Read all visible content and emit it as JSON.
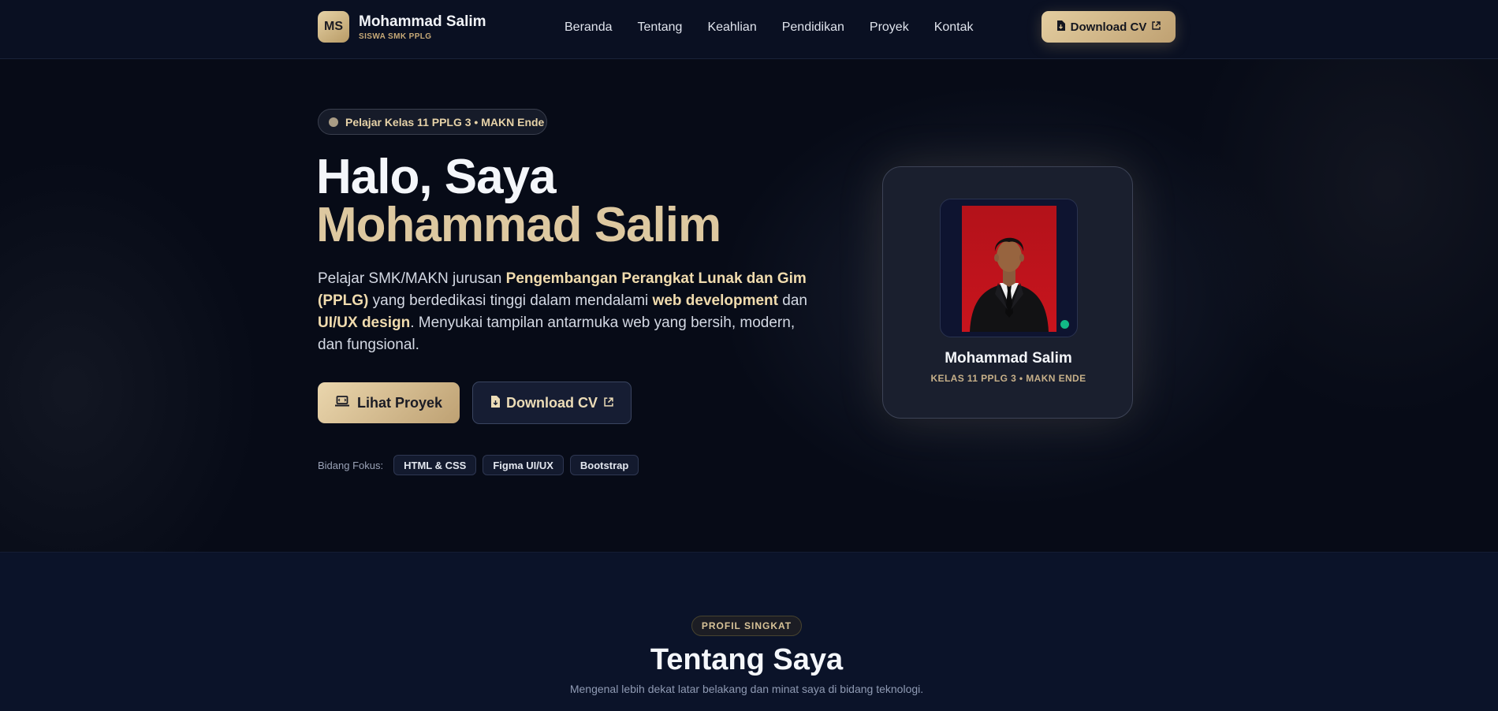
{
  "brand": {
    "logo": "MS",
    "name": "Mohammad Salim",
    "subtitle": "SISWA SMK PPLG"
  },
  "nav": {
    "links": [
      "Beranda",
      "Tentang",
      "Keahlian",
      "Pendidikan",
      "Proyek",
      "Kontak"
    ],
    "cv_button": "Download CV"
  },
  "hero": {
    "badge": "Pelajar Kelas 11 PPLG 3 • MAKN Ende",
    "title_line1": "Halo, Saya",
    "title_line2": "Mohammad Salim",
    "desc": {
      "p1": "Pelajar SMK/MAKN jurusan ",
      "h1": "Pengembangan Perangkat Lunak dan Gim (PPLG)",
      "p2": " yang berdedikasi tinggi dalam mendalami ",
      "h2": "web development",
      "p3": " dan ",
      "h3": "UI/UX design",
      "p4": ". Menyukai tampilan antarmuka web yang bersih, modern, dan fungsional."
    },
    "btn_projects": "Lihat Proyek",
    "btn_cv": "Download CV",
    "focus_label": "Bidang Fokus:",
    "focus_chips": [
      "HTML & CSS",
      "Figma UI/UX",
      "Bootstrap"
    ]
  },
  "profile_card": {
    "name": "Mohammad Salim",
    "subtitle": "KELAS 11 PPLG 3 • MAKN ENDE",
    "status": "online"
  },
  "about": {
    "badge": "PROFIL SINGKAT",
    "title": "Tentang Saya",
    "subtitle": "Mengenal lebih dekat latar belakang dan minat saya di bidang teknologi."
  },
  "colors": {
    "accent_gold": "#ddc8a0",
    "background": "#070b17",
    "online_dot": "#12b886"
  },
  "icons": [
    "file-icon",
    "external-link-icon",
    "laptop-icon"
  ]
}
